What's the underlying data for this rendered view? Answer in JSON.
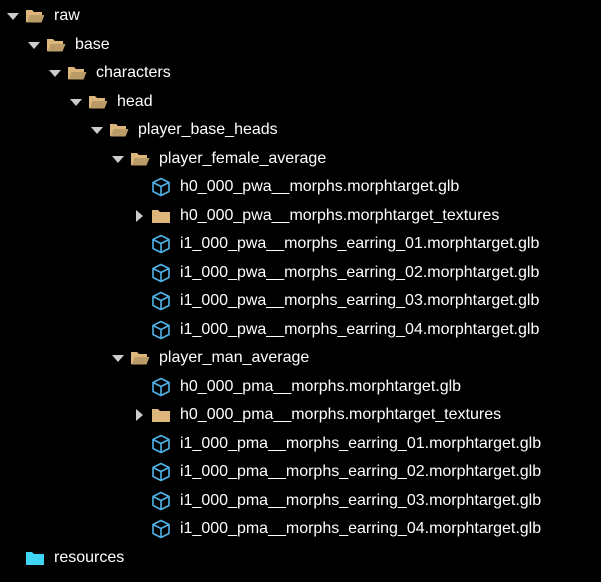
{
  "colors": {
    "background": "#000000",
    "text": "#ffffff",
    "folder": "#dcb67a",
    "folder_open": "#dcb67a",
    "special_folder": "#3fd6f5",
    "file_3d": "#4fb3e8",
    "chevron": "#cccccc"
  },
  "tree": [
    {
      "label": "raw",
      "depth": 0,
      "type": "folder",
      "expanded": true,
      "icon": "folder-open-icon"
    },
    {
      "label": "base",
      "depth": 1,
      "type": "folder",
      "expanded": true,
      "icon": "folder-open-icon"
    },
    {
      "label": "characters",
      "depth": 2,
      "type": "folder",
      "expanded": true,
      "icon": "folder-open-icon"
    },
    {
      "label": "head",
      "depth": 3,
      "type": "folder",
      "expanded": true,
      "icon": "folder-open-icon"
    },
    {
      "label": "player_base_heads",
      "depth": 4,
      "type": "folder",
      "expanded": true,
      "icon": "folder-open-icon"
    },
    {
      "label": "player_female_average",
      "depth": 5,
      "type": "folder",
      "expanded": true,
      "icon": "folder-open-icon"
    },
    {
      "label": "h0_000_pwa__morphs.morphtarget.glb",
      "depth": 6,
      "type": "file",
      "icon": "cube-icon"
    },
    {
      "label": "h0_000_pwa__morphs.morphtarget_textures",
      "depth": 6,
      "type": "folder",
      "expanded": false,
      "icon": "folder-icon"
    },
    {
      "label": "i1_000_pwa__morphs_earring_01.morphtarget.glb",
      "depth": 6,
      "type": "file",
      "icon": "cube-icon"
    },
    {
      "label": "i1_000_pwa__morphs_earring_02.morphtarget.glb",
      "depth": 6,
      "type": "file",
      "icon": "cube-icon"
    },
    {
      "label": "i1_000_pwa__morphs_earring_03.morphtarget.glb",
      "depth": 6,
      "type": "file",
      "icon": "cube-icon"
    },
    {
      "label": "i1_000_pwa__morphs_earring_04.morphtarget.glb",
      "depth": 6,
      "type": "file",
      "icon": "cube-icon"
    },
    {
      "label": "player_man_average",
      "depth": 5,
      "type": "folder",
      "expanded": true,
      "icon": "folder-open-icon"
    },
    {
      "label": "h0_000_pma__morphs.morphtarget.glb",
      "depth": 6,
      "type": "file",
      "icon": "cube-icon"
    },
    {
      "label": "h0_000_pma__morphs.morphtarget_textures",
      "depth": 6,
      "type": "folder",
      "expanded": false,
      "icon": "folder-icon"
    },
    {
      "label": "i1_000_pma__morphs_earring_01.morphtarget.glb",
      "depth": 6,
      "type": "file",
      "icon": "cube-icon"
    },
    {
      "label": "i1_000_pma__morphs_earring_02.morphtarget.glb",
      "depth": 6,
      "type": "file",
      "icon": "cube-icon"
    },
    {
      "label": "i1_000_pma__morphs_earring_03.morphtarget.glb",
      "depth": 6,
      "type": "file",
      "icon": "cube-icon"
    },
    {
      "label": "i1_000_pma__morphs_earring_04.morphtarget.glb",
      "depth": 6,
      "type": "file",
      "icon": "cube-icon"
    },
    {
      "label": "resources",
      "depth": 0,
      "type": "folder",
      "special": true,
      "icon": "folder-special-icon"
    }
  ]
}
